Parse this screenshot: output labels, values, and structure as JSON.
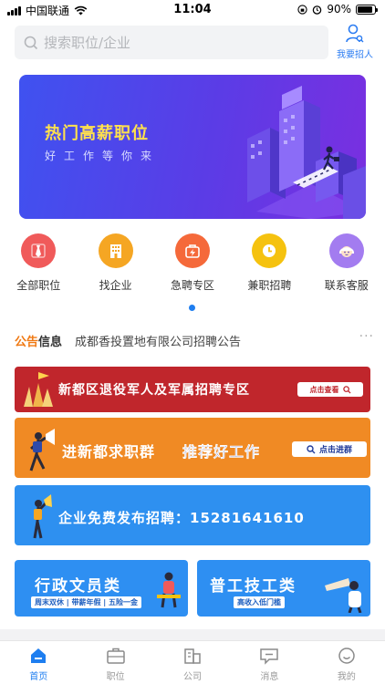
{
  "status": {
    "carrier": "中国联通",
    "time": "11:04",
    "battery": "90%",
    "battery_level": 0.9
  },
  "search": {
    "placeholder": "搜索职位/企业"
  },
  "recruit": {
    "label": "我要招人"
  },
  "banner": {
    "title": "热门高薪职位",
    "subtitle": "好工作等你来"
  },
  "categories": [
    {
      "label": "全部职位",
      "icon": "tie-icon",
      "color": "#f05a5a"
    },
    {
      "label": "找企业",
      "icon": "building-icon",
      "color": "#f5a623"
    },
    {
      "label": "急聘专区",
      "icon": "bag-icon",
      "color": "#f5693a"
    },
    {
      "label": "兼职招聘",
      "icon": "clock-icon",
      "color": "#f5c20f"
    },
    {
      "label": "联系客服",
      "icon": "service-icon",
      "color": "#a37cf0"
    }
  ],
  "notice": {
    "tag_a": "公告",
    "tag_b": "信息",
    "text": "成都香投置地有限公司招聘公告",
    "more": "···"
  },
  "ads": [
    {
      "title": "新都区退役军人及军属招聘专区",
      "button": "点击查看",
      "color": "#c0262c"
    },
    {
      "title": "进新都求职群",
      "highlight": "推荐好工作",
      "button": "点击进群",
      "color": "#f08a24"
    },
    {
      "title": "企业免费发布招聘：15281641610",
      "color": "#2e90f0"
    }
  ],
  "tiles": [
    {
      "title": "行政文员类",
      "sub": "周末双休 | 带薪年假 | 五险一金"
    },
    {
      "title": "普工技工类",
      "sub": "高收入低门槛"
    }
  ],
  "tabs": [
    {
      "label": "首页",
      "icon": "home-icon",
      "active": true
    },
    {
      "label": "职位",
      "icon": "briefcase-icon",
      "active": false
    },
    {
      "label": "公司",
      "icon": "company-icon",
      "active": false
    },
    {
      "label": "消息",
      "icon": "message-icon",
      "active": false
    },
    {
      "label": "我的",
      "icon": "smile-icon",
      "active": false
    }
  ]
}
